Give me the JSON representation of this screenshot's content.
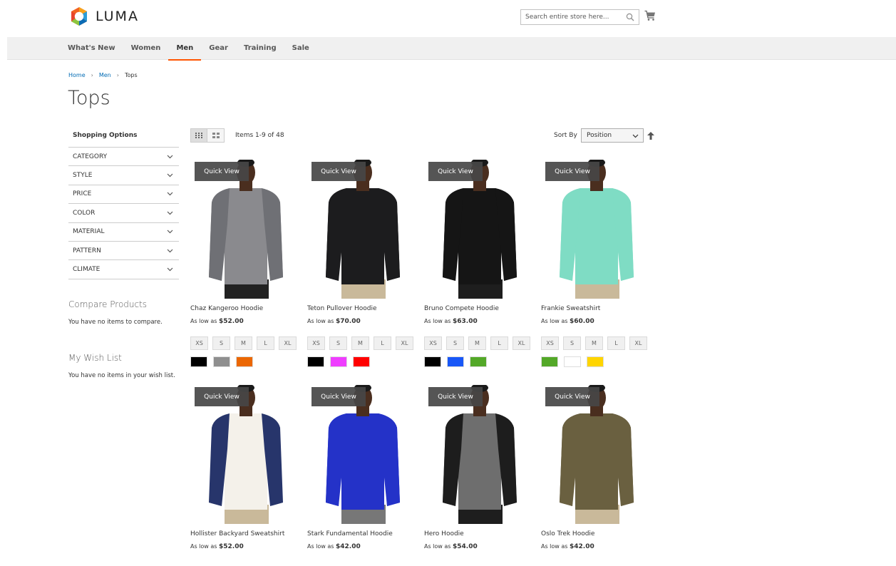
{
  "header": {
    "logo_text": "LUMA",
    "search_placeholder": "Search entire store here...",
    "icons": [
      "search-icon",
      "cart-icon"
    ]
  },
  "nav": {
    "items": [
      {
        "label": "What's New"
      },
      {
        "label": "Women"
      },
      {
        "label": "Men",
        "active": true
      },
      {
        "label": "Gear"
      },
      {
        "label": "Training"
      },
      {
        "label": "Sale"
      }
    ]
  },
  "breadcrumb": [
    "Home",
    "Men",
    "Tops"
  ],
  "page_title": "Tops",
  "sidebar": {
    "title": "Shopping Options",
    "filters": [
      "CATEGORY",
      "STYLE",
      "PRICE",
      "COLOR",
      "MATERIAL",
      "PATTERN",
      "CLIMATE"
    ],
    "compare_title": "Compare Products",
    "compare_text": "You have no items to compare.",
    "wishlist_title": "My Wish List",
    "wishlist_text": "You have no items in your wish list."
  },
  "toolbar": {
    "amount": "Items 1-9 of 48",
    "sort_label": "Sort By",
    "sort_value": "Position"
  },
  "quick_view_label": "Quick View",
  "price_prefix": "As low as",
  "products": [
    {
      "name": "Chaz Kangeroo Hoodie",
      "price": "$52.00",
      "sizes": [
        "XS",
        "S",
        "M",
        "L",
        "XL"
      ],
      "colors": [
        "#000000",
        "#8f8f8f",
        "#eb6703"
      ],
      "shirt": "#8a8a8e",
      "sleeve": "#6f7075",
      "pants": "#222"
    },
    {
      "name": "Teton Pullover Hoodie",
      "price": "$70.00",
      "sizes": [
        "XS",
        "S",
        "M",
        "L",
        "XL"
      ],
      "colors": [
        "#000000",
        "#ef3dff",
        "#ff0000"
      ],
      "shirt": "#1c1c1e",
      "sleeve": "#1c1c1e",
      "pants": "#c9b99a"
    },
    {
      "name": "Bruno Compete Hoodie",
      "price": "$63.00",
      "sizes": [
        "XS",
        "S",
        "M",
        "L",
        "XL"
      ],
      "colors": [
        "#000000",
        "#1857f7",
        "#53a828"
      ],
      "shirt": "#151515",
      "sleeve": "#151515",
      "pants": "#1e1e1e"
    },
    {
      "name": "Frankie Sweatshirt",
      "price": "$60.00",
      "sizes": [
        "XS",
        "S",
        "M",
        "L",
        "XL"
      ],
      "colors": [
        "#53a828",
        "#ffffff",
        "#ffd500"
      ],
      "shirt": "#7fdcc4",
      "sleeve": "#7fdcc4",
      "pants": "#c9b99a"
    },
    {
      "name": "Hollister Backyard Sweatshirt",
      "price": "$52.00",
      "shirt": "#f4f1ea",
      "sleeve": "#27356b",
      "pants": "#c9b99a"
    },
    {
      "name": "Stark Fundamental Hoodie",
      "price": "$42.00",
      "shirt": "#2432c8",
      "sleeve": "#2432c8",
      "pants": "#777"
    },
    {
      "name": "Hero Hoodie",
      "price": "$54.00",
      "shirt": "#6e6e6e",
      "sleeve": "#1d1d1d",
      "pants": "#1e1e1e"
    },
    {
      "name": "Oslo Trek Hoodie",
      "price": "$42.00",
      "shirt": "#6a6040",
      "sleeve": "#6a6040",
      "pants": "#c9b99a"
    }
  ],
  "colors": {
    "accent": "#ff5501",
    "link": "#006bb4"
  }
}
